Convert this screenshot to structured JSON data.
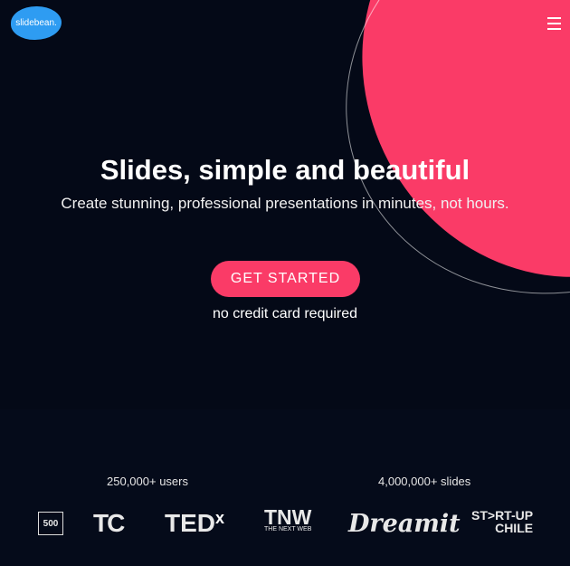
{
  "brand": {
    "logo_text": "slidebean."
  },
  "nav": {
    "menu_icon": "hamburger-icon"
  },
  "hero": {
    "title": "Slides, simple and beautiful",
    "subtitle": "Create stunning, professional presentations in minutes, not hours.",
    "cta_label": "GET STARTED",
    "note": "no credit card required",
    "accent": "#fa3b67",
    "background": "#040917"
  },
  "stats": {
    "users": "250,000+ users",
    "slides": "4,000,000+ slides"
  },
  "partners": [
    {
      "name": "500",
      "icon": "500-startups-logo"
    },
    {
      "name": "TC",
      "icon": "techcrunch-logo"
    },
    {
      "name": "TED",
      "x": "x",
      "icon": "tedx-logo"
    },
    {
      "name": "TNW",
      "sub": "THE NEXT WEB",
      "icon": "tnw-logo"
    },
    {
      "name": "Dreamit",
      "icon": "dreamit-logo"
    },
    {
      "name": "ST>RT-UP",
      "sub": "CHILE",
      "icon": "startup-chile-logo"
    }
  ]
}
